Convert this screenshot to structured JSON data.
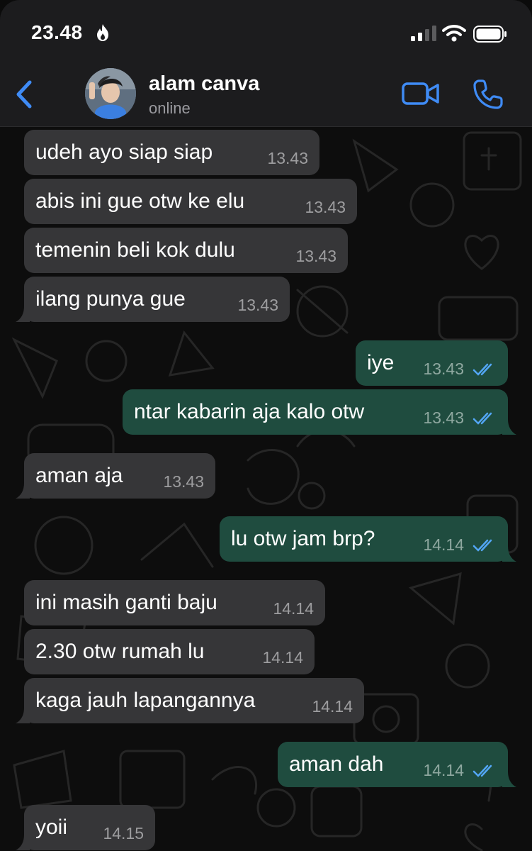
{
  "status_bar": {
    "time": "23.48"
  },
  "header": {
    "contact_name": "alam canva",
    "contact_status": "online"
  },
  "colors": {
    "accent": "#3f8bf5",
    "incoming_bubble": "#363638",
    "outgoing_bubble": "#1f4c3f",
    "read_ticks": "#53a6f5"
  },
  "icons": [
    "flame-icon",
    "signal-icon",
    "wifi-icon",
    "battery-icon",
    "back-arrow-icon",
    "video-call-icon",
    "phone-icon",
    "double-check-icon"
  ],
  "messages": [
    {
      "direction": "in",
      "text": "udeh ayo siap siap",
      "time": "13.43"
    },
    {
      "direction": "in",
      "text": "abis ini gue otw ke elu",
      "time": "13.43"
    },
    {
      "direction": "in",
      "text": "temenin beli kok dulu",
      "time": "13.43"
    },
    {
      "direction": "in",
      "text": "ilang punya gue",
      "time": "13.43"
    },
    {
      "direction": "out",
      "text": "iye",
      "time": "13.43",
      "read": true
    },
    {
      "direction": "out",
      "text": "ntar kabarin aja kalo otw",
      "time": "13.43",
      "read": true
    },
    {
      "direction": "in",
      "text": "aman aja",
      "time": "13.43"
    },
    {
      "direction": "out",
      "text": "lu otw jam brp?",
      "time": "14.14",
      "read": true
    },
    {
      "direction": "in",
      "text": "ini masih ganti baju",
      "time": "14.14"
    },
    {
      "direction": "in",
      "text": "2.30 otw rumah lu",
      "time": "14.14"
    },
    {
      "direction": "in",
      "text": "kaga jauh lapangannya",
      "time": "14.14"
    },
    {
      "direction": "out",
      "text": "aman dah",
      "time": "14.14",
      "read": true
    },
    {
      "direction": "in",
      "text": "yoii",
      "time": "14.15"
    }
  ]
}
